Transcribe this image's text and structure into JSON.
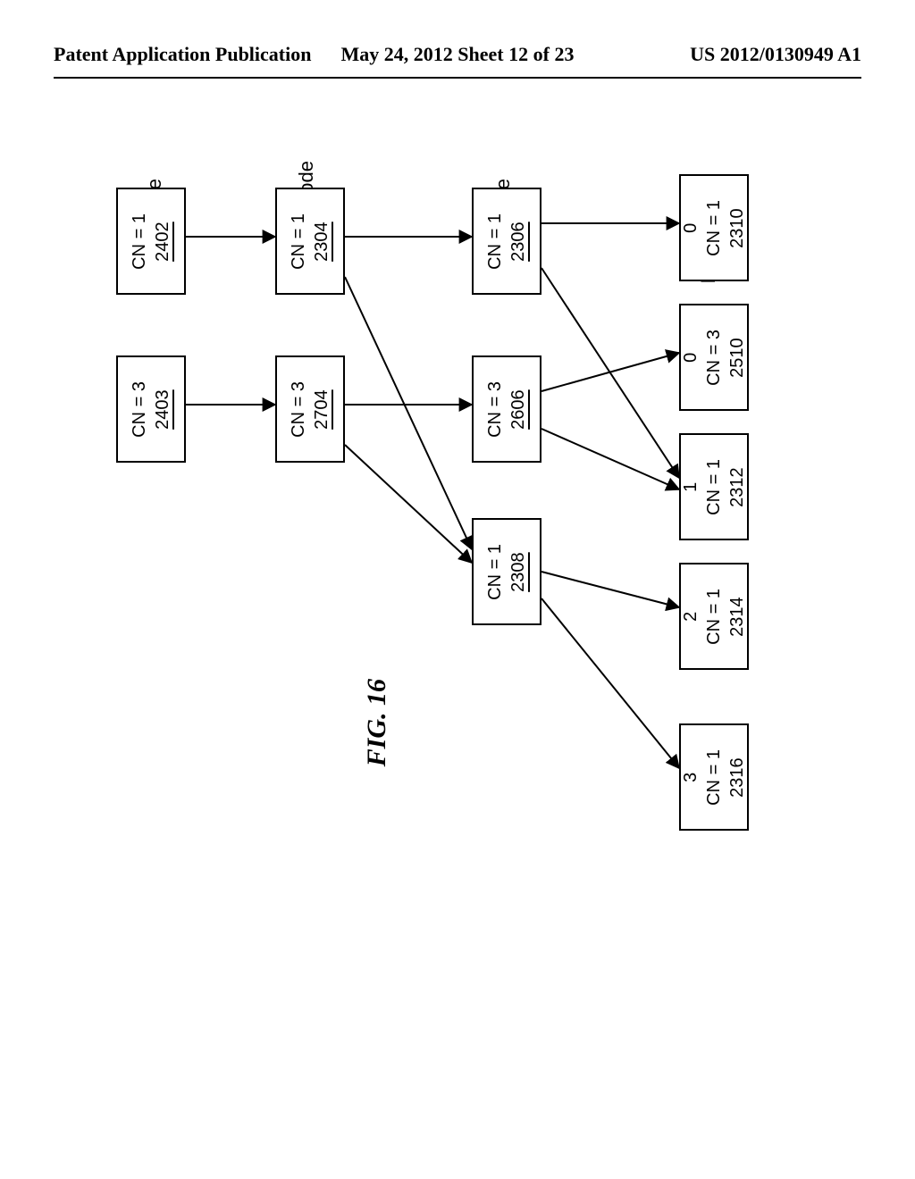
{
  "header": {
    "left": "Patent Application Publication",
    "mid": "May 24, 2012  Sheet 12 of 23",
    "right": "US 2012/0130949 A1"
  },
  "figure_label": "FIG. 16",
  "columns": {
    "root": {
      "label": "Root Onode"
    },
    "indirect": {
      "label": "Indirect Onode"
    },
    "direct": {
      "label": "Direct Onode"
    },
    "data": {
      "label": "Data Blocks"
    }
  },
  "nodes": {
    "root_2402": {
      "cn": "CN = 1",
      "ref": "2402"
    },
    "root_2403": {
      "cn": "CN = 3",
      "ref": "2403"
    },
    "indirect_2304": {
      "cn": "CN = 1",
      "ref": "2304"
    },
    "indirect_2704": {
      "cn": "CN = 3",
      "ref": "2704"
    },
    "direct_2306": {
      "cn": "CN = 1",
      "ref": "2306"
    },
    "direct_2606": {
      "cn": "CN = 3",
      "ref": "2606"
    },
    "direct_2308": {
      "cn": "CN = 1",
      "ref": "2308"
    },
    "data_2310": {
      "idx": "0",
      "cn": "CN = 1",
      "ref": "2310"
    },
    "data_2510": {
      "idx": "0",
      "cn": "CN = 3",
      "ref": "2510"
    },
    "data_2312": {
      "idx": "1",
      "cn": "CN = 1",
      "ref": "2312"
    },
    "data_2314": {
      "idx": "2",
      "cn": "CN = 1",
      "ref": "2314"
    },
    "data_2316": {
      "idx": "3",
      "cn": "CN = 1",
      "ref": "2316"
    }
  }
}
